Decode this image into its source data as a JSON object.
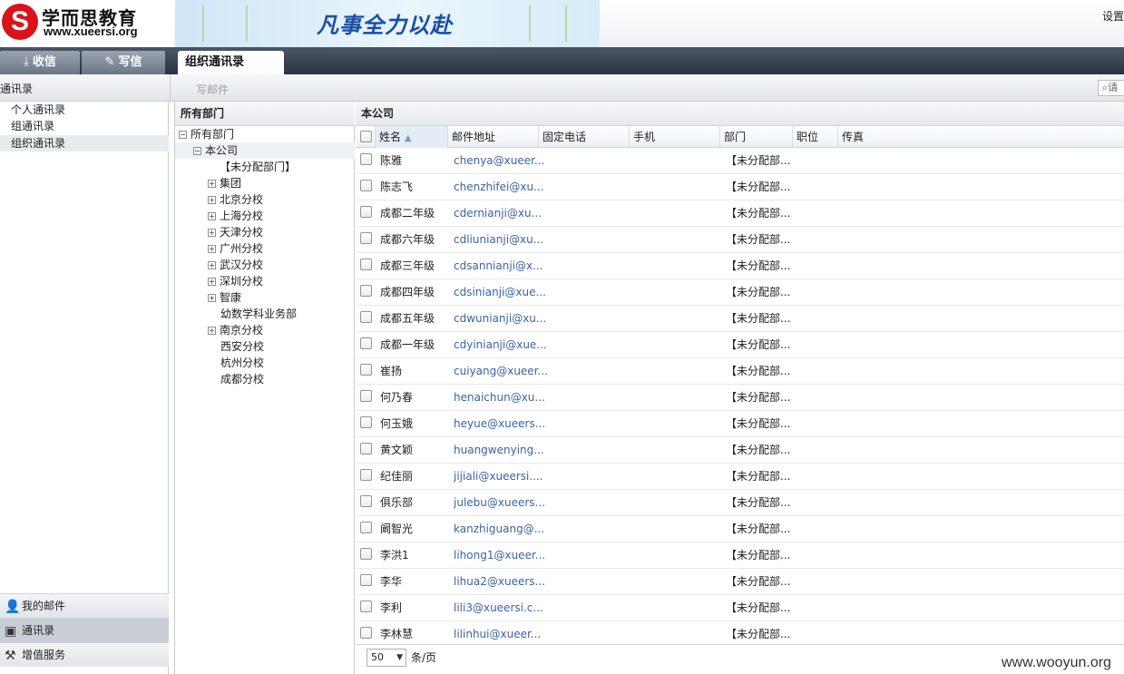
{
  "header": {
    "logo_mark": "S",
    "brand_name": "学而思教育",
    "brand_url": "www.xueersi.org",
    "banner_slogan": "凡事全力以赴",
    "settings_label": "设置"
  },
  "tabs": [
    {
      "label": "收信",
      "icon": "download-icon"
    },
    {
      "label": "写信",
      "icon": "compose-icon"
    }
  ],
  "active_tab": "组织通讯录",
  "toolbar": {
    "section_title": "通讯录",
    "write_mail": "写邮件",
    "search_placeholder": "请"
  },
  "left_nav": {
    "items": [
      "个人通讯录",
      "组通讯录",
      "组织通讯录"
    ],
    "selected": "组织通讯录",
    "bottom": [
      {
        "label": "我的邮件",
        "icon": "user-mail-icon"
      },
      {
        "label": "通讯录",
        "icon": "contacts-icon"
      },
      {
        "label": "增值服务",
        "icon": "tools-icon"
      }
    ]
  },
  "tree": {
    "header": "所有部门",
    "root": "所有部门",
    "company": "本公司",
    "children": [
      {
        "label": "【未分配部门】",
        "expandable": false
      },
      {
        "label": "集团",
        "expandable": true
      },
      {
        "label": "北京分校",
        "expandable": true
      },
      {
        "label": "上海分校",
        "expandable": true
      },
      {
        "label": "天津分校",
        "expandable": true
      },
      {
        "label": "广州分校",
        "expandable": true
      },
      {
        "label": "武汉分校",
        "expandable": true
      },
      {
        "label": "深圳分校",
        "expandable": true
      },
      {
        "label": "智康",
        "expandable": true
      },
      {
        "label": "幼数学科业务部",
        "expandable": false
      },
      {
        "label": "南京分校",
        "expandable": true
      },
      {
        "label": "西安分校",
        "expandable": false
      },
      {
        "label": "杭州分校",
        "expandable": false
      },
      {
        "label": "成都分校",
        "expandable": false
      }
    ]
  },
  "grid": {
    "title": "本公司",
    "columns": [
      "姓名",
      "邮件地址",
      "固定电话",
      "手机",
      "部门",
      "职位",
      "传真"
    ],
    "rows": [
      {
        "name": "陈雅",
        "email": "chenya@xueer...",
        "dept": "【未分配部..."
      },
      {
        "name": "陈志飞",
        "email": "chenzhifei@xu...",
        "dept": "【未分配部..."
      },
      {
        "name": "成都二年级",
        "email": "cdernianji@xu...",
        "dept": "【未分配部..."
      },
      {
        "name": "成都六年级",
        "email": "cdliunianji@xu...",
        "dept": "【未分配部..."
      },
      {
        "name": "成都三年级",
        "email": "cdsannianji@x...",
        "dept": "【未分配部..."
      },
      {
        "name": "成都四年级",
        "email": "cdsinianji@xue...",
        "dept": "【未分配部..."
      },
      {
        "name": "成都五年级",
        "email": "cdwunianji@xu...",
        "dept": "【未分配部..."
      },
      {
        "name": "成都一年级",
        "email": "cdyinianji@xue...",
        "dept": "【未分配部..."
      },
      {
        "name": "崔扬",
        "email": "cuiyang@xueer...",
        "dept": "【未分配部..."
      },
      {
        "name": "何乃春",
        "email": "henaichun@xu...",
        "dept": "【未分配部..."
      },
      {
        "name": "何玉娥",
        "email": "heyue@xueers...",
        "dept": "【未分配部..."
      },
      {
        "name": "黄文颖",
        "email": "huangwenying...",
        "dept": "【未分配部..."
      },
      {
        "name": "纪佳丽",
        "email": "jijiali@xueersi....",
        "dept": "【未分配部..."
      },
      {
        "name": "俱乐部",
        "email": "julebu@xueers...",
        "dept": "【未分配部..."
      },
      {
        "name": "阚智光",
        "email": "kanzhiguang@...",
        "dept": "【未分配部..."
      },
      {
        "name": "李洪1",
        "email": "lihong1@xueer...",
        "dept": "【未分配部..."
      },
      {
        "name": "李华",
        "email": "lihua2@xueers...",
        "dept": "【未分配部..."
      },
      {
        "name": "李利",
        "email": "lili3@xueersi.c...",
        "dept": "【未分配部..."
      },
      {
        "name": "李林慧",
        "email": "lilinhui@xueer...",
        "dept": "【未分配部..."
      }
    ],
    "page_size": "50",
    "per_page_label": "条/页"
  },
  "watermark": "www.wooyun.org"
}
